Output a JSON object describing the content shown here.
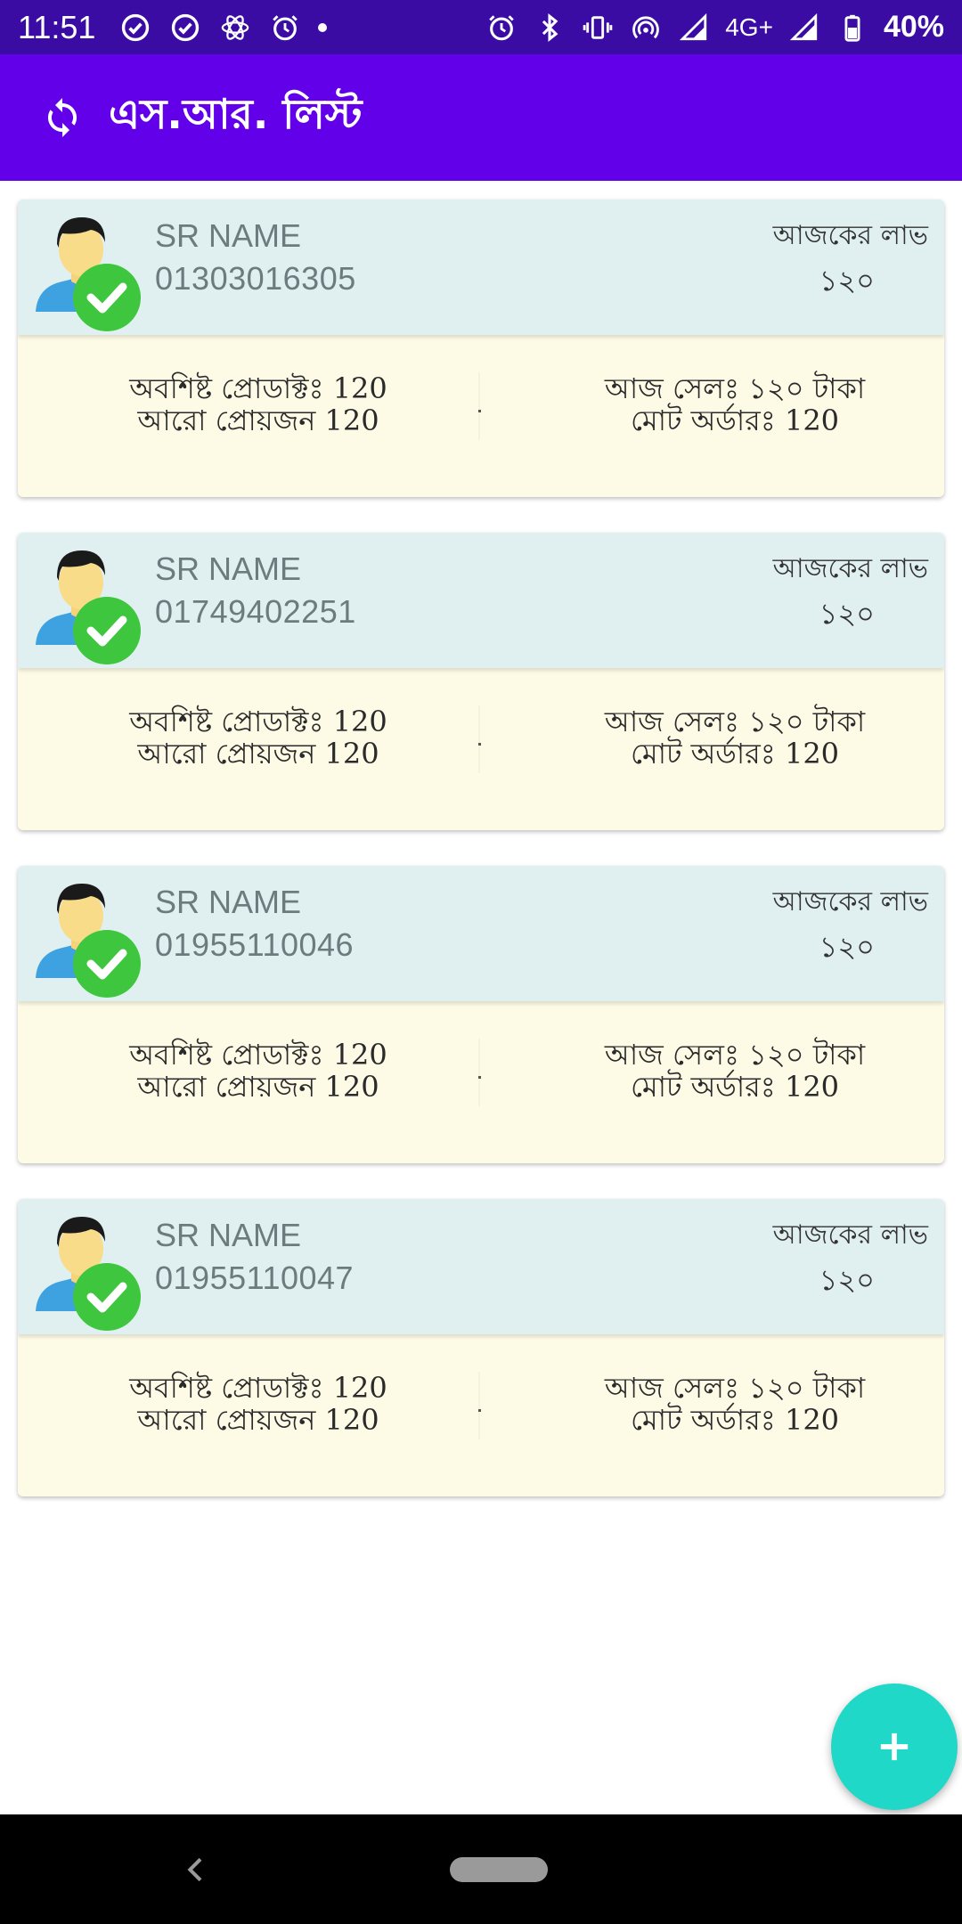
{
  "status_bar": {
    "time": "11:51",
    "left_icons": [
      "check-circle-icon",
      "check-circle-icon",
      "settings-flower-icon",
      "alarm-icon",
      "dot-icon"
    ],
    "right_icons": [
      "alarm-icon",
      "bluetooth-icon",
      "vibrate-icon",
      "hotspot-icon",
      "signal-icon",
      "signal-icon",
      "battery-icon"
    ],
    "network": "4G+",
    "battery": "40%",
    "background": "#3a0ca3"
  },
  "app_bar": {
    "title": "এস.আর. লিস্ট",
    "icon": "refresh-icon",
    "background": "#6200ea"
  },
  "sr_list": [
    {
      "name": "SR NAME",
      "phone": "01303016305",
      "profit_label": "আজকের লাভ",
      "profit_value": "১২০",
      "remaining_products": "অবশিষ্ট প্রোডাক্টঃ 120",
      "more_needed": "আরো প্রোয়জন 120",
      "today_sale": "আজ সেলঃ ১২০ টাকা",
      "total_order": "মোট অর্ডারঃ 120"
    },
    {
      "name": "SR NAME",
      "phone": "01749402251",
      "profit_label": "আজকের লাভ",
      "profit_value": "১২০",
      "remaining_products": "অবশিষ্ট প্রোডাক্টঃ 120",
      "more_needed": "আরো প্রোয়জন 120",
      "today_sale": "আজ সেলঃ ১২০ টাকা",
      "total_order": "মোট অর্ডারঃ 120"
    },
    {
      "name": "SR NAME",
      "phone": "01955110046",
      "profit_label": "আজকের লাভ",
      "profit_value": "১২০",
      "remaining_products": "অবশিষ্ট প্রোডাক্টঃ 120",
      "more_needed": "আরো প্রোয়জন 120",
      "today_sale": "আজ সেলঃ ১২০ টাকা",
      "total_order": "মোট অর্ডারঃ 120"
    },
    {
      "name": "SR NAME",
      "phone": "01955110047",
      "profit_label": "আজকের লাভ",
      "profit_value": "১২০",
      "remaining_products": "অবশিষ্ট প্রোডাক্টঃ 120",
      "more_needed": "আরো প্রোয়জন 120",
      "today_sale": "আজ সেলঃ ১২০ টাকা",
      "total_order": "মোট অর্ডারঃ 120"
    }
  ],
  "fab": {
    "icon": "plus-icon",
    "color": "#1fd8c8"
  },
  "nav_bar": {
    "back_icon": "back-chevron-icon",
    "home_icon": "home-pill-icon"
  },
  "colors": {
    "card_header": "#e0f0f1",
    "card_body": "#fdfbe6",
    "check_badge": "#3ec73e"
  }
}
